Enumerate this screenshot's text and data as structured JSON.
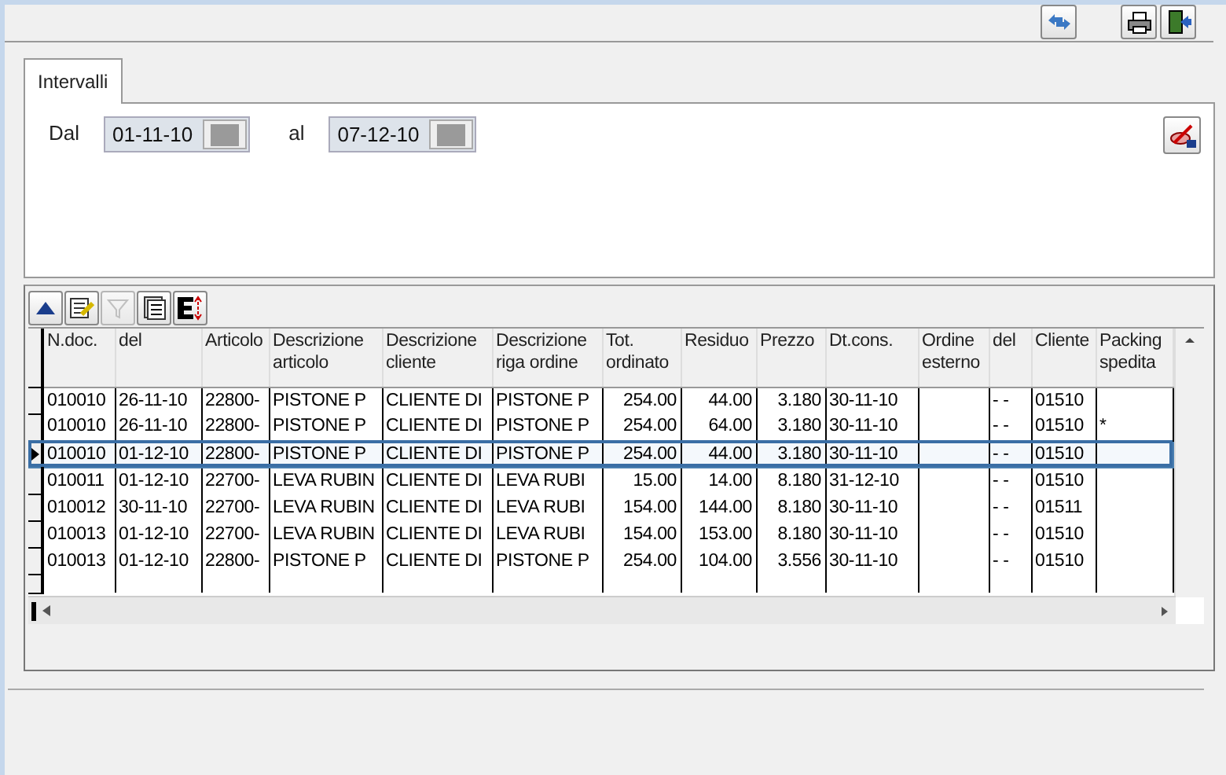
{
  "tab": {
    "label": "Intervalli",
    "selected": true
  },
  "filters": [
    {
      "label": "Dal",
      "value": "01-11-10"
    },
    {
      "label": "al",
      "value": "07-12-10"
    }
  ],
  "grid_toolbar": [
    {
      "kind": "up",
      "disabled": false
    },
    {
      "kind": "edit",
      "disabled": false
    },
    {
      "kind": "filter",
      "disabled": true
    },
    {
      "kind": "list",
      "disabled": false
    },
    {
      "kind": "export",
      "disabled": false
    }
  ],
  "table": {
    "columns": [
      "N.doc.",
      "del",
      "Articolo",
      "Descrizione articolo",
      "Descrizione cliente",
      "Descrizione riga ordine",
      "Tot. ordinato",
      "Residuo",
      "Prezzo",
      "Dt.cons.",
      "Ordine esterno",
      "del",
      "Cliente",
      "Packing spedita"
    ],
    "rows": [
      {
        "selected": false,
        "cells": [
          "010010",
          "26-11-10",
          "22800-",
          "PISTONE P",
          "CLIENTE DI",
          "PISTONE P",
          "254.00",
          "44.00",
          "3.180",
          "30-11-10",
          "",
          "- -",
          "01510",
          ""
        ]
      },
      {
        "selected": false,
        "cells": [
          "010010",
          "26-11-10",
          "22800-",
          "PISTONE P",
          "CLIENTE DI",
          "PISTONE P",
          "254.00",
          "64.00",
          "3.180",
          "30-11-10",
          "",
          "- -",
          "01510",
          "*"
        ]
      },
      {
        "selected": true,
        "cells": [
          "010010",
          "01-12-10",
          "22800-",
          "PISTONE P",
          "CLIENTE DI",
          "PISTONE P",
          "254.00",
          "44.00",
          "3.180",
          "30-11-10",
          "",
          "- -",
          "01510",
          ""
        ]
      },
      {
        "selected": false,
        "cells": [
          "010011",
          "01-12-10",
          "22700-",
          "LEVA RUBIN",
          "CLIENTE DI",
          "LEVA RUBI",
          "15.00",
          "14.00",
          "8.180",
          "31-12-10",
          "",
          "- -",
          "01510",
          ""
        ]
      },
      {
        "selected": false,
        "cells": [
          "010012",
          "30-11-10",
          "22700-",
          "LEVA RUBIN",
          "CLIENTE DI",
          "LEVA RUBI",
          "154.00",
          "144.00",
          "8.180",
          "30-11-10",
          "",
          "- -",
          "01511",
          ""
        ]
      },
      {
        "selected": false,
        "cells": [
          "010013",
          "01-12-10",
          "22700-",
          "LEVA RUBIN",
          "CLIENTE DI",
          "LEVA RUBI",
          "154.00",
          "153.00",
          "8.180",
          "30-11-10",
          "",
          "- -",
          "01510",
          ""
        ]
      },
      {
        "selected": false,
        "cells": [
          "010013",
          "01-12-10",
          "22800-",
          "PISTONE P",
          "CLIENTE DI",
          "PISTONE P",
          "254.00",
          "104.00",
          "3.556",
          "30-11-10",
          "",
          "- -",
          "01510",
          ""
        ]
      }
    ]
  }
}
